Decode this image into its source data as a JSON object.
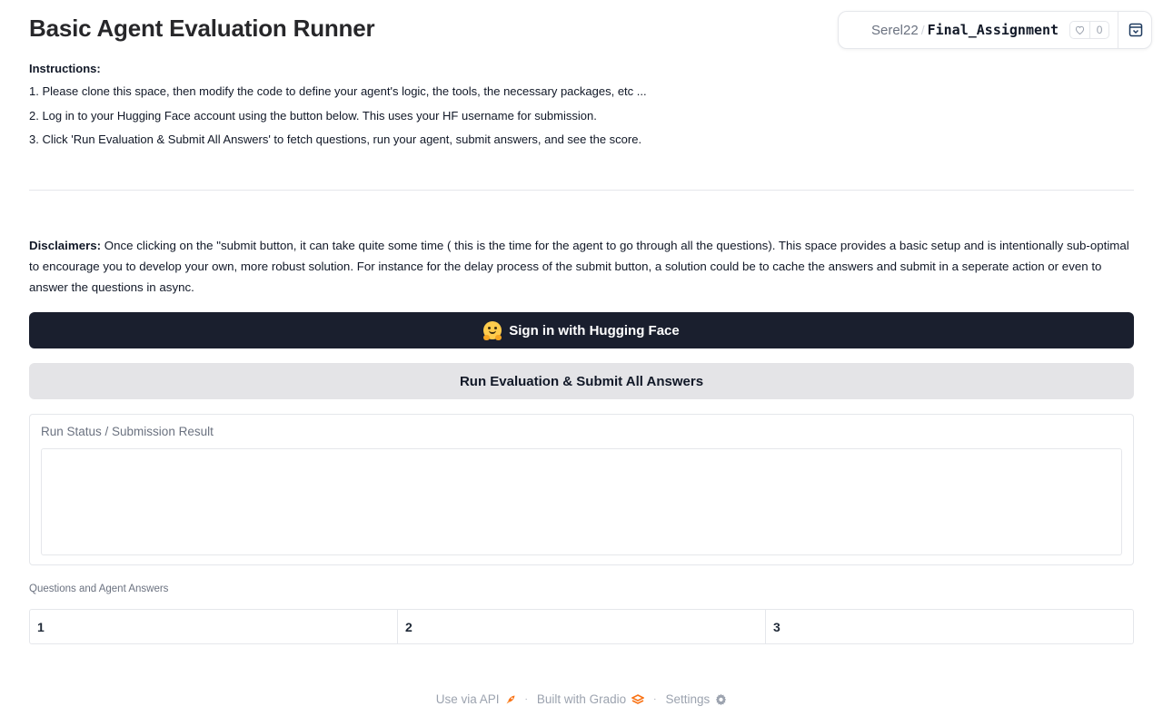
{
  "title": "Basic Agent Evaluation Runner",
  "space_badge": {
    "owner": "Serel22",
    "separator": "/",
    "repo": "Final_Assignment",
    "likes": "0"
  },
  "instructions": {
    "heading": "Instructions:",
    "lines": [
      "1. Please clone this space, then modify the code to define your agent's logic, the tools, the necessary packages, etc ...",
      "2. Log in to your Hugging Face account using the button below. This uses your HF username for submission.",
      "3. Click 'Run Evaluation & Submit All Answers' to fetch questions, run your agent, submit answers, and see the score."
    ]
  },
  "disclaimer": {
    "heading": "Disclaimers:",
    "text": " Once clicking on the \"submit button, it can take quite some time ( this is the time for the agent to go through all the questions). This space provides a basic setup and is intentionally sub-optimal to encourage you to develop your own, more robust solution. For instance for the delay process of the submit button, a solution could be to cache the answers and submit in a seperate action or even to answer the questions in async."
  },
  "buttons": {
    "signin": "Sign in with Hugging Face",
    "run": "Run Evaluation & Submit All Answers"
  },
  "status": {
    "label": "Run Status / Submission Result",
    "value": ""
  },
  "qa_table": {
    "label": "Questions and Agent Answers",
    "columns": [
      "1",
      "2",
      "3"
    ]
  },
  "footer": {
    "api": "Use via API",
    "built": "Built with Gradio",
    "settings": "Settings"
  },
  "colors": {
    "signin_bg": "#1a1f2e",
    "run_bg": "#e4e4e7",
    "gradio_orange": "#f97316"
  }
}
